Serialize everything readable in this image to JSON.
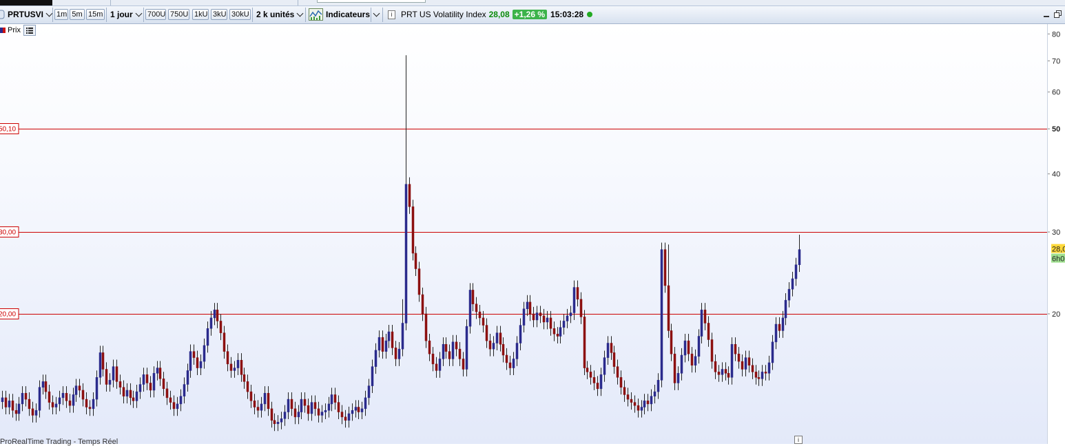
{
  "toolbar": {
    "symbol": "PRTUSVI",
    "intervals": [
      "1m",
      "5m",
      "15m"
    ],
    "timeframe": "1 jour",
    "tick_intervals": [
      "700U",
      "750U",
      "1kU",
      "3kU",
      "30kU"
    ],
    "units": "2 k unités",
    "indicators": "Indicateurs",
    "instrument_name": "PRT US Volatility Index",
    "last_price": "28,08",
    "change_pct": "+1,26 %",
    "time": "15:03:28",
    "status_color": "#22aa22",
    "price_color": "#0a8a0a",
    "change_bg": "#3cb34a"
  },
  "chart_header": {
    "label": "Prix"
  },
  "footer": {
    "source": "ProRealTime Trading - Temps Réel"
  },
  "colors": {
    "up": "#2a2a8c",
    "down": "#8c1010",
    "hline": "#cc0000"
  },
  "chart_data": {
    "type": "candlestick",
    "scale": "log",
    "ylim": [
      10.5,
      84
    ],
    "y_ticks": [
      "80",
      "70",
      "60",
      "50",
      "40",
      "30",
      "20"
    ],
    "y_tick_values": [
      80,
      70,
      60,
      50,
      40,
      30,
      20
    ],
    "y_tick_bold": [
      false,
      false,
      false,
      true,
      false,
      false,
      false
    ],
    "horizontal_lines": [
      {
        "value": 50.1,
        "label": "50,10"
      },
      {
        "value": 30.0,
        "label": "30,00"
      },
      {
        "value": 20.0,
        "label": "20,00"
      }
    ],
    "current_price_label": "28,0",
    "countdown_label": "6h0",
    "close_series": [
      13.2,
      12.6,
      13.0,
      12.4,
      12.2,
      12.8,
      13.5,
      13.1,
      12.5,
      12.1,
      12.4,
      13.9,
      14.3,
      13.6,
      12.9,
      12.6,
      12.8,
      13.2,
      13.5,
      13.0,
      12.7,
      13.4,
      14.0,
      13.7,
      13.1,
      12.6,
      12.5,
      13.1,
      14.6,
      16.5,
      15.2,
      14.1,
      14.4,
      15.4,
      14.3,
      13.9,
      13.3,
      13.7,
      13.2,
      13.0,
      13.6,
      14.1,
      14.8,
      14.2,
      13.7,
      14.9,
      15.3,
      14.5,
      13.8,
      13.2,
      12.9,
      12.5,
      12.8,
      13.3,
      14.1,
      15.1,
      16.6,
      16.1,
      15.3,
      15.8,
      17.1,
      18.6,
      19.6,
      20.4,
      19.3,
      18.2,
      16.6,
      15.6,
      15.1,
      15.3,
      15.9,
      14.8,
      14.3,
      13.6,
      13.0,
      12.6,
      12.4,
      12.8,
      13.5,
      12.5,
      11.8,
      11.6,
      11.7,
      11.9,
      12.3,
      13.1,
      12.5,
      12.0,
      12.3,
      13.1,
      12.7,
      12.2,
      12.9,
      12.5,
      12.1,
      12.3,
      12.4,
      12.8,
      13.4,
      12.9,
      12.3,
      12.0,
      11.8,
      12.2,
      12.4,
      12.6,
      12.3,
      12.5,
      13.2,
      14.0,
      15.4,
      16.7,
      17.8,
      16.6,
      17.5,
      18.3,
      16.9,
      16.0,
      16.8,
      19.1,
      38.0,
      34.0,
      27.0,
      25.0,
      22.0,
      20.0,
      17.5,
      16.4,
      15.6,
      15.1,
      16.0,
      17.2,
      16.6,
      16.0,
      17.4,
      16.8,
      16.0,
      15.2,
      18.8,
      22.5,
      21.0,
      20.2,
      19.6,
      18.9,
      17.5,
      16.8,
      17.3,
      18.2,
      17.2,
      16.3,
      15.7,
      15.3,
      16.0,
      17.3,
      18.9,
      20.5,
      21.2,
      20.0,
      19.4,
      20.1,
      19.8,
      19.2,
      19.6,
      18.6,
      18.1,
      17.9,
      18.7,
      19.3,
      19.8,
      20.1,
      22.8,
      21.5,
      19.7,
      15.3,
      15.0,
      14.6,
      14.2,
      13.8,
      14.8,
      16.1,
      17.3,
      16.5,
      15.4,
      14.6,
      13.9,
      13.4,
      13.1,
      12.9,
      12.7,
      12.4,
      12.6,
      13.0,
      12.8,
      13.3,
      13.6,
      14.4,
      27.5,
      23.0,
      18.4,
      16.4,
      14.2,
      14.9,
      16.3,
      17.5,
      16.4,
      15.5,
      16.2,
      17.9,
      20.4,
      19.1,
      17.6,
      15.8,
      15.0,
      14.8,
      15.2,
      14.9,
      14.6,
      17.2,
      16.4,
      15.8,
      15.2,
      16.1,
      15.5,
      15.0,
      14.6,
      14.5,
      15.0,
      14.9,
      15.7,
      17.4,
      19.0,
      18.4,
      19.6,
      21.4,
      22.6,
      23.8,
      25.5,
      27.5
    ]
  }
}
